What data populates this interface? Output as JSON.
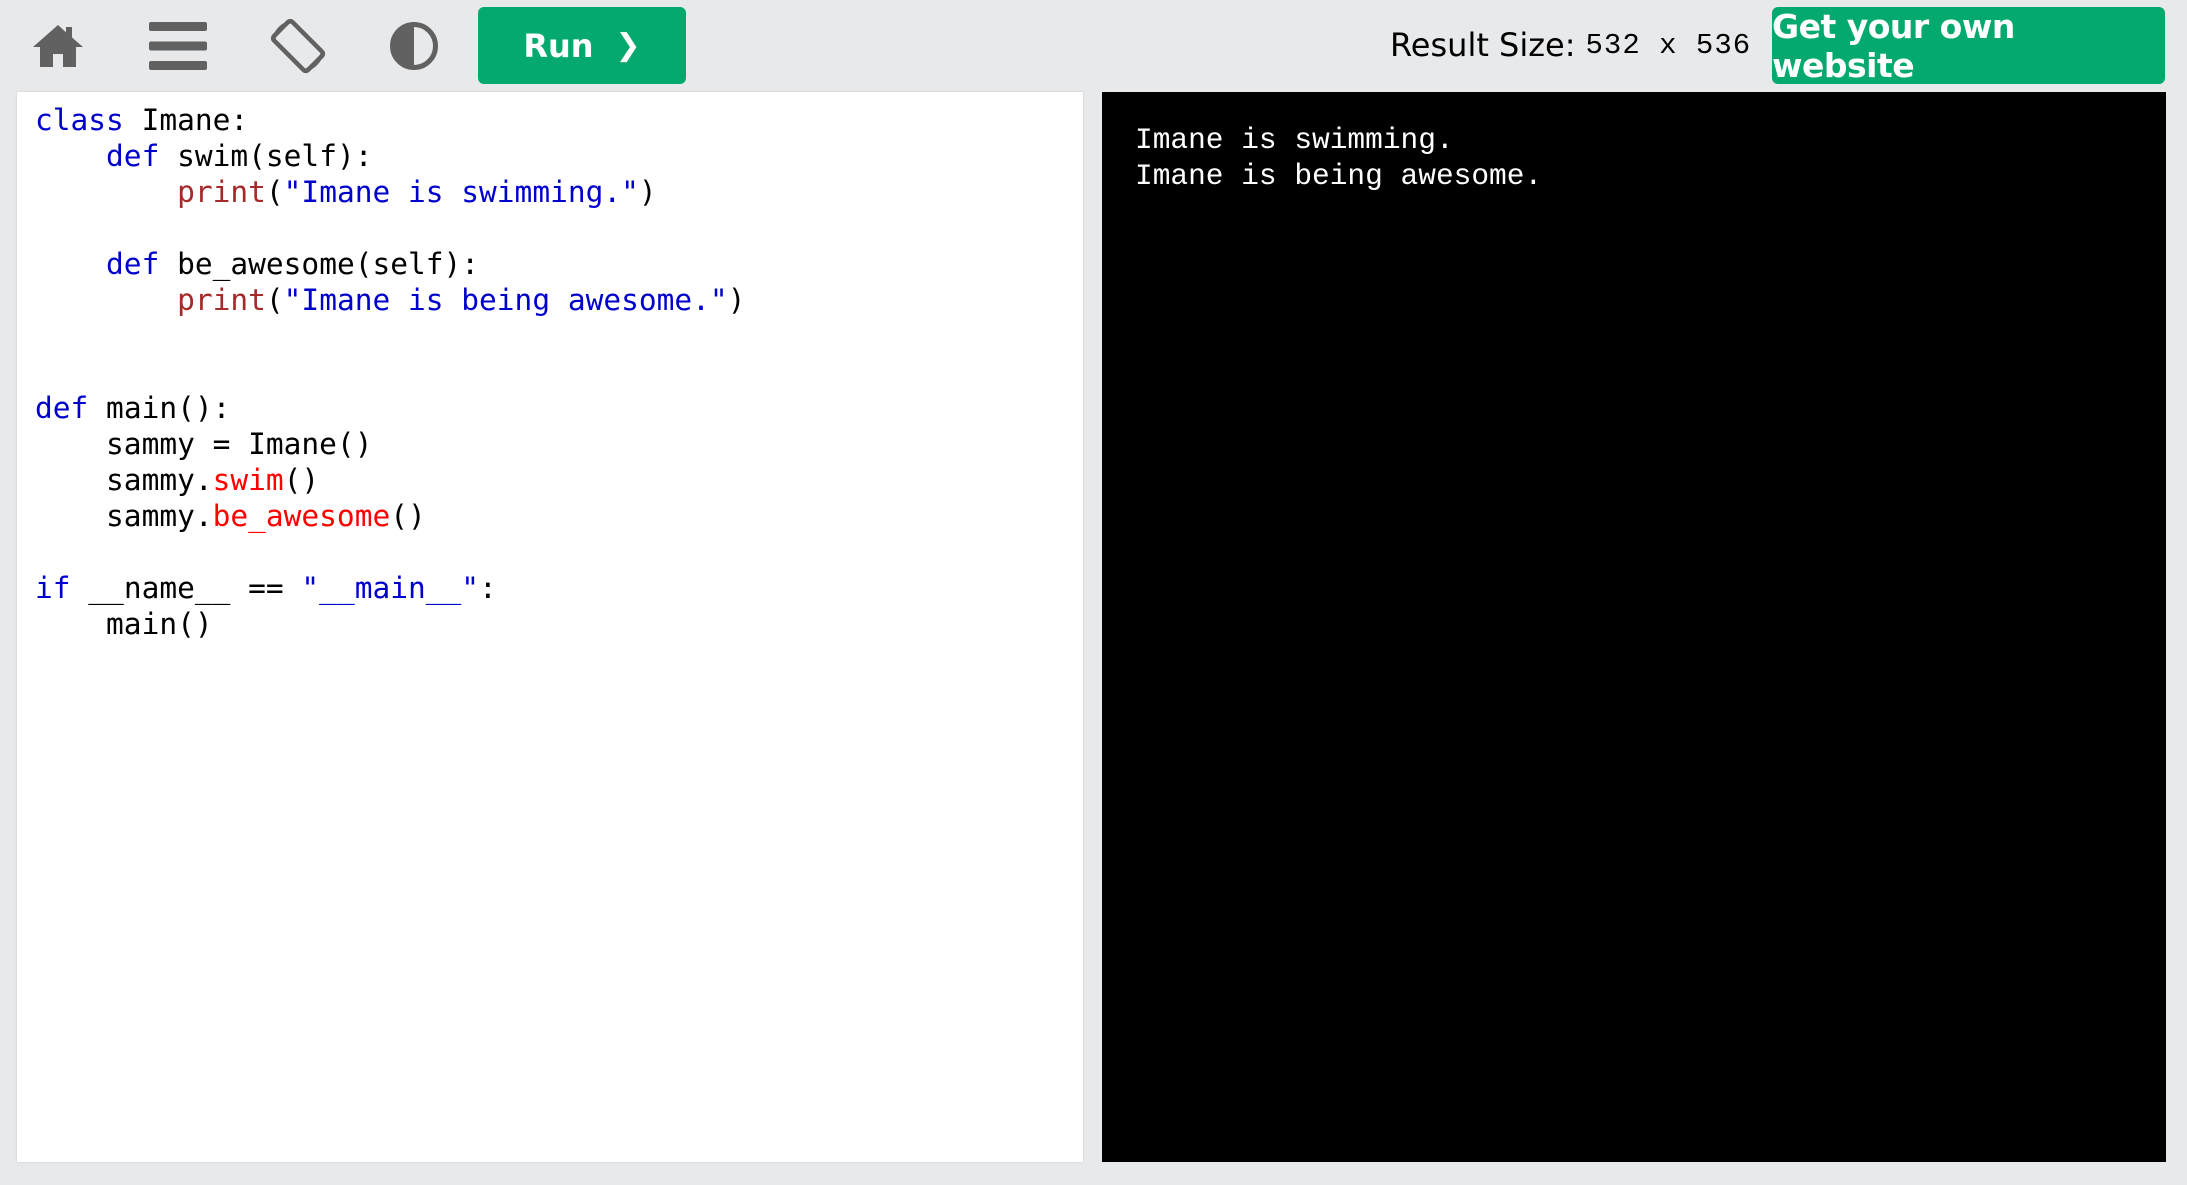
{
  "toolbar": {
    "home_icon": "home-icon",
    "menu_icon": "menu-icon",
    "rotate_icon": "rotate-orientation-icon",
    "theme_icon": "contrast-icon",
    "run_label": "Run",
    "run_chevron": "❯",
    "result_size_label": "Result Size:",
    "result_size_value": "532 x 536",
    "own_website_label": "Get your own website"
  },
  "editor": {
    "language": "python",
    "lines": [
      "class Imane:",
      "    def swim(self):",
      "        print(\"Imane is swimming.\")",
      "",
      "    def be_awesome(self):",
      "        print(\"Imane is being awesome.\")",
      "",
      "",
      "def main():",
      "    sammy = Imane()",
      "    sammy.swim()",
      "    sammy.be_awesome()",
      "",
      "if __name__ == \"__main__\":",
      "    main()"
    ]
  },
  "output": {
    "lines": [
      "Imane is swimming.",
      "Imane is being awesome."
    ]
  },
  "colors": {
    "accent_green": "#04aa6d",
    "toolbar_bg": "#e7e9eb",
    "keyword_blue": "#0000cd",
    "builtin_brown": "#a52a2a",
    "method_red": "#ff0000",
    "output_bg": "#000000",
    "output_text": "#ffffff"
  }
}
